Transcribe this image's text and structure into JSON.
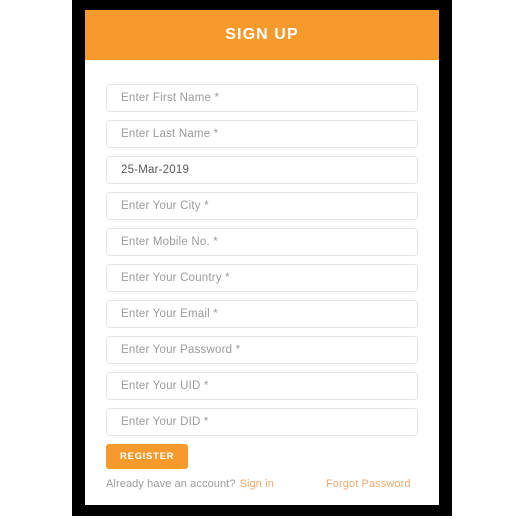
{
  "header": {
    "title": "SIGN UP",
    "background_color": "#f59a2b",
    "text_color": "#ffffff"
  },
  "form": {
    "fields": [
      {
        "name": "first-name",
        "text": "Enter First Name *",
        "filled": false
      },
      {
        "name": "last-name",
        "text": "Enter Last Name *",
        "filled": false
      },
      {
        "name": "date-of-birth",
        "text": "25-Mar-2019",
        "filled": true
      },
      {
        "name": "city",
        "text": "Enter Your City *",
        "filled": false
      },
      {
        "name": "mobile-no",
        "text": "Enter Mobile No. *",
        "filled": false
      },
      {
        "name": "country",
        "text": "Enter Your Country *",
        "filled": false
      },
      {
        "name": "email",
        "text": "Enter Your Email *",
        "filled": false
      },
      {
        "name": "password",
        "text": "Enter Your Password *",
        "filled": false
      },
      {
        "name": "uid",
        "text": "Enter Your UID *",
        "filled": false
      },
      {
        "name": "did",
        "text": "Enter Your DID *",
        "filled": false
      }
    ]
  },
  "actions": {
    "register_label": "REGISTER",
    "have_account_text": "Already have an account?",
    "signin_label": "Sign in",
    "forgot_password_label": "Forgot Password",
    "accent_color": "#f59a2b",
    "link_color": "#f0a868"
  }
}
